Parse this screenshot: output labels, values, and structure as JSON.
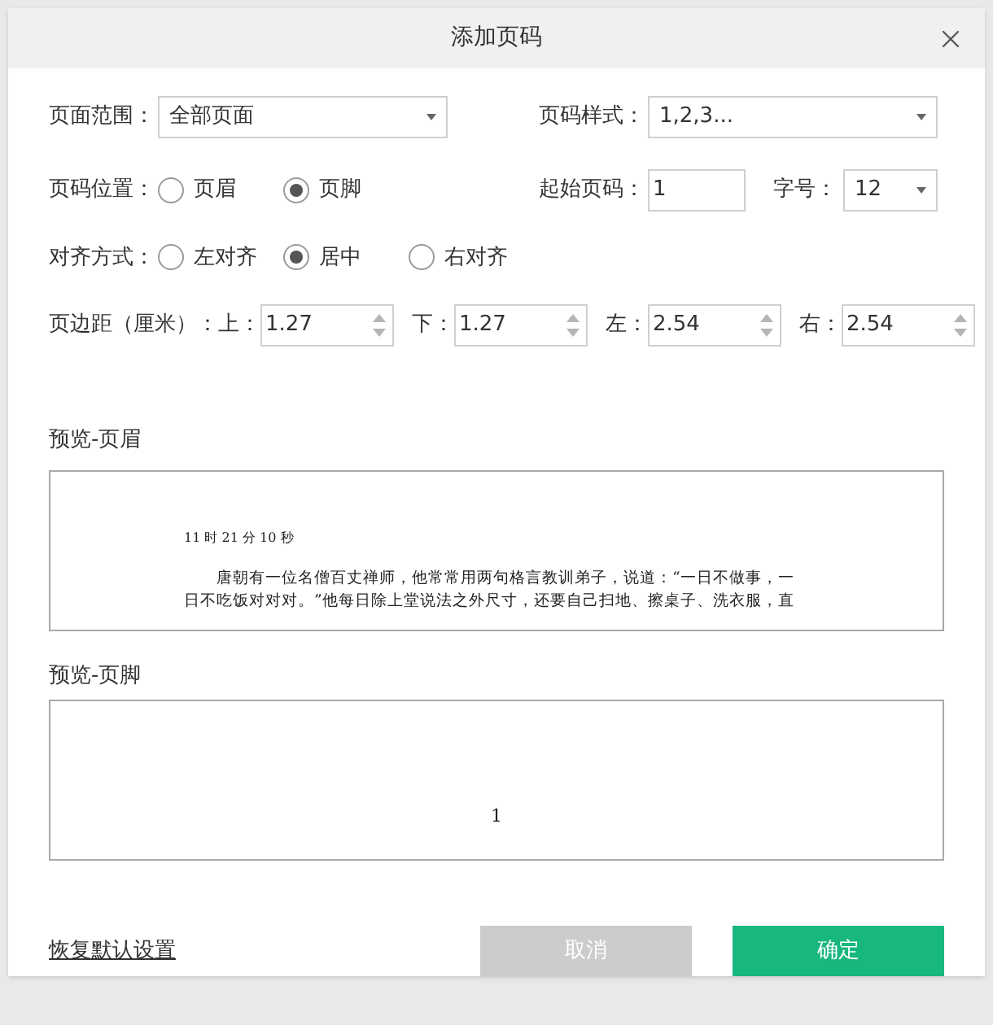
{
  "dialog": {
    "title": "添加页码"
  },
  "page_range": {
    "label": "页面范围：",
    "value": "全部页面"
  },
  "number_style": {
    "label": "页码样式：",
    "value": "1,2,3..."
  },
  "position": {
    "label": "页码位置：",
    "options": [
      {
        "label": "页眉",
        "selected": false
      },
      {
        "label": "页脚",
        "selected": true
      }
    ]
  },
  "start_number": {
    "label": "起始页码：",
    "value": "1"
  },
  "font_size": {
    "label": "字号：",
    "value": "12"
  },
  "alignment": {
    "label": "对齐方式：",
    "options": [
      {
        "label": "左对齐",
        "selected": false
      },
      {
        "label": "居中",
        "selected": true
      },
      {
        "label": "右对齐",
        "selected": false
      }
    ]
  },
  "margins": {
    "label": "页边距（厘米）：",
    "fields": [
      {
        "label": "上：",
        "value": "1.27"
      },
      {
        "label": "下：",
        "value": "1.27"
      },
      {
        "label": "左：",
        "value": "2.54"
      },
      {
        "label": "右：",
        "value": "2.54"
      }
    ]
  },
  "preview_header": {
    "label": "预览-页眉",
    "time": "11 时 21 分 10 秒",
    "lines": [
      "　　唐朝有一位名僧百丈禅师，他常常用两句格言教训弟子，说道：“一日不做事，一",
      "日不吃饭对对对。”他每日除上堂说法之外尺寸，还要自己扫地、擦桌子、洗衣服，直"
    ]
  },
  "preview_footer": {
    "label": "预览-页脚",
    "page_number": "1"
  },
  "reset_link": "恢复默认设置",
  "buttons": [
    {
      "label": "取消",
      "kind": "disabled"
    },
    {
      "label": "确定",
      "kind": "primary"
    }
  ]
}
